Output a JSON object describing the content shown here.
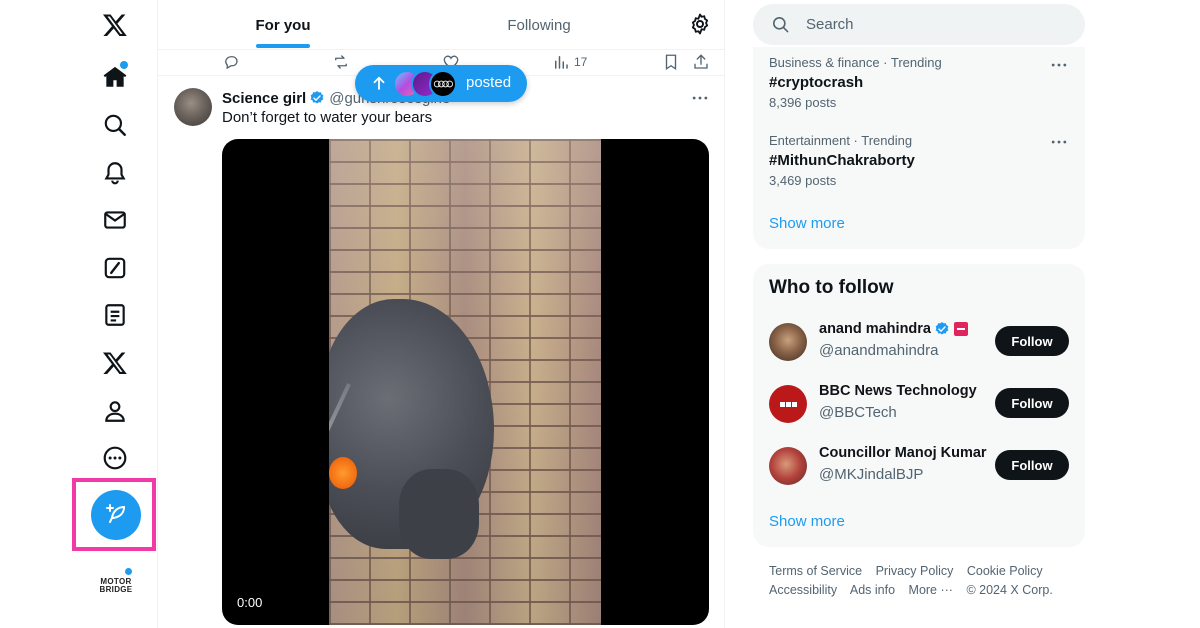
{
  "nav": {
    "items": [
      "x-logo-icon",
      "home-icon",
      "explore-icon",
      "notifications-icon",
      "messages-icon",
      "grok-icon",
      "lists-icon",
      "premium-icon",
      "profile-icon",
      "more-icon"
    ],
    "account_logo_line1": "MOTOR",
    "account_logo_line2": "BRIDGE"
  },
  "header": {
    "tabs": [
      {
        "label": "For you",
        "active": true
      },
      {
        "label": "Following",
        "active": false
      }
    ]
  },
  "previous_tweet_actions": {
    "views": "17"
  },
  "new_posts_pill": {
    "label": "posted"
  },
  "tweet": {
    "name": "Science girl",
    "handle": "@gunsnrosesgirl3",
    "text": "Don’t forget to water your bears",
    "video_time": "0:00"
  },
  "search": {
    "placeholder": "Search"
  },
  "trends": [
    {
      "meta": "Business & finance · Trending",
      "tag": "#cryptocrash",
      "count": "8,396 posts"
    },
    {
      "meta": "Entertainment · Trending",
      "tag": "#MithunChakraborty",
      "count": "3,469 posts"
    }
  ],
  "trends_show_more": "Show more",
  "who_to_follow": {
    "title": "Who to follow",
    "accounts": [
      {
        "name": "anand mahindra",
        "handle": "@anandmahindra",
        "button": "Follow"
      },
      {
        "name": "BBC News Technology",
        "handle": "@BBCTech",
        "button": "Follow"
      },
      {
        "name": "Councillor Manoj Kumar",
        "handle": "@MKJindalBJP",
        "button": "Follow"
      }
    ],
    "show_more": "Show more"
  },
  "footer": {
    "line1": [
      "Terms of Service",
      "Privacy Policy",
      "Cookie Policy"
    ],
    "line2": [
      "Accessibility",
      "Ads info",
      "More ···",
      "© 2024 X Corp."
    ]
  },
  "colors": {
    "accent": "#1d9bf0",
    "text": "#0f1419",
    "muted": "#536471",
    "highlight": "#f13aa6"
  }
}
